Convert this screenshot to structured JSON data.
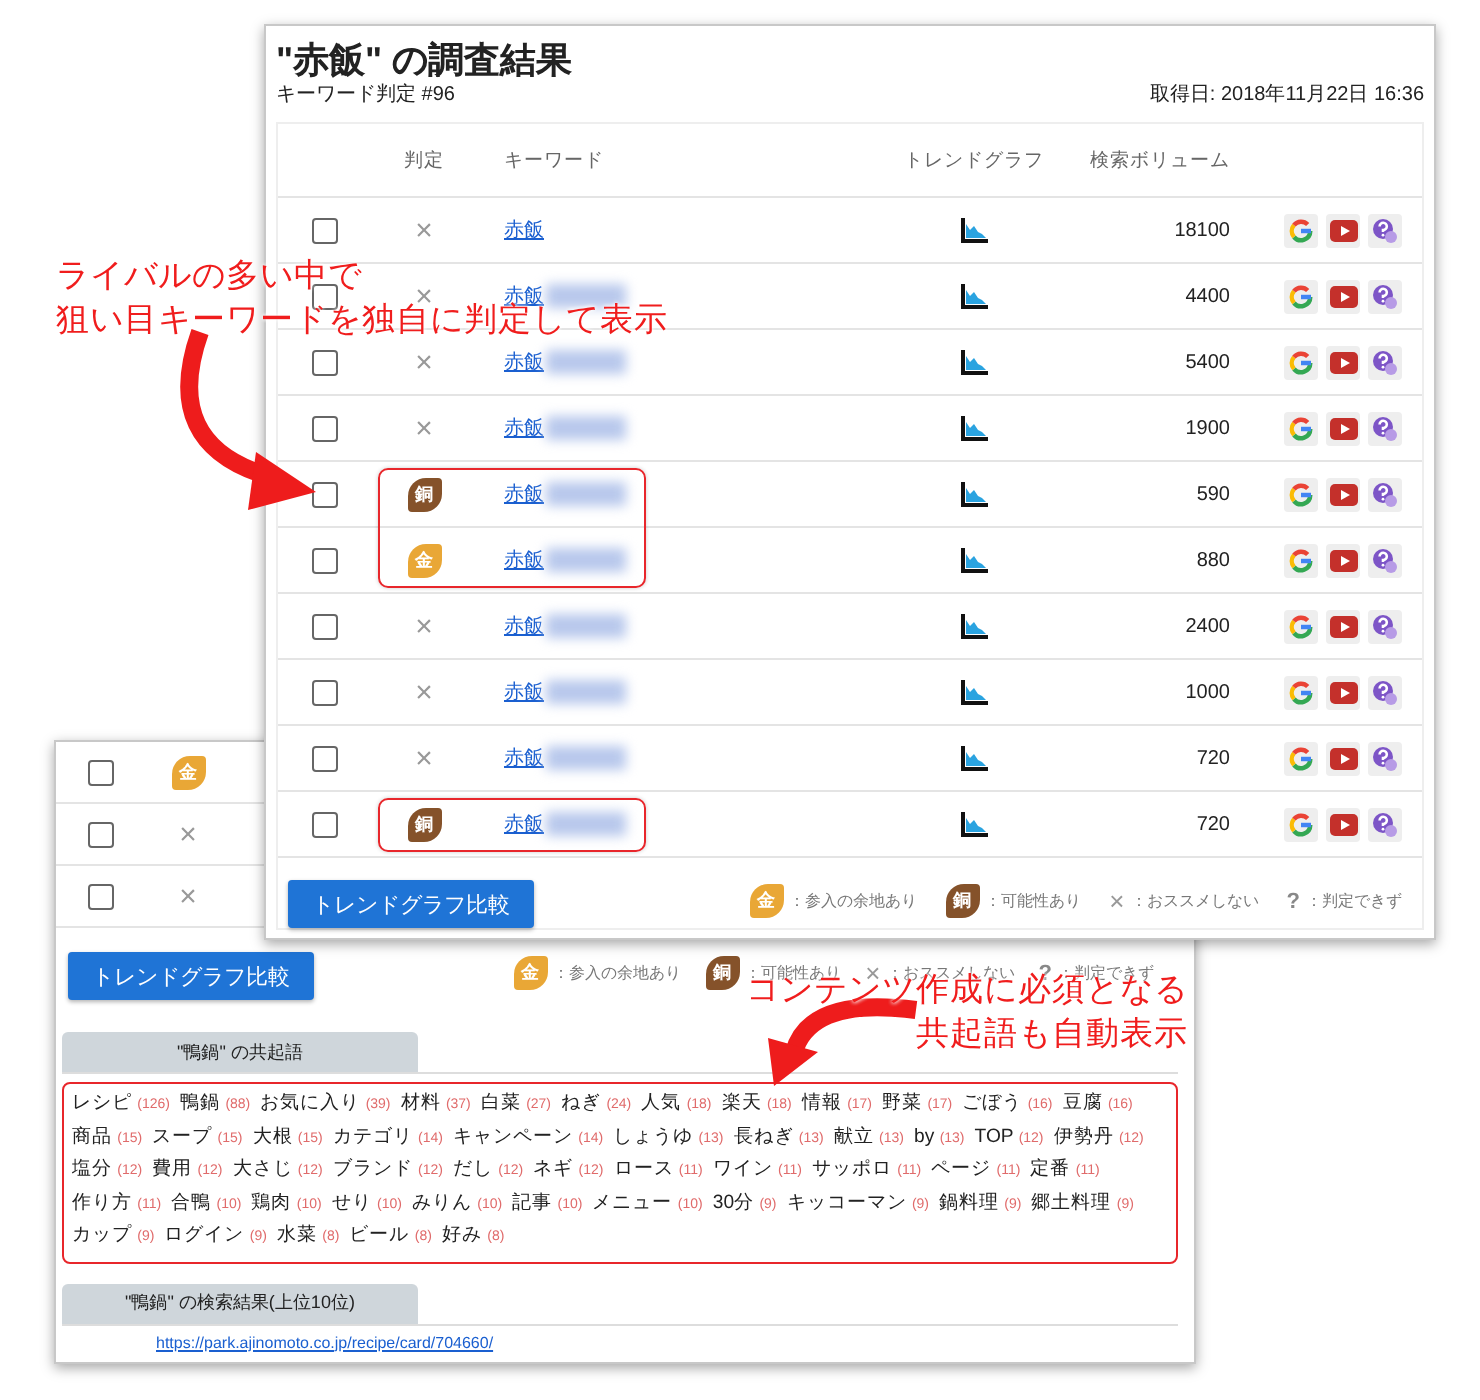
{
  "front_window": {
    "title": "\"赤飯\" の調査結果",
    "subtitle": "キーワード判定 #96",
    "fetched": "取得日: 2018年11月22日 16:36",
    "columns": [
      "判定",
      "キーワード",
      "トレンドグラフ",
      "検索ボリューム"
    ],
    "rows": [
      {
        "checked": false,
        "verdict": {
          "kind": "x",
          "text": "×"
        },
        "keyword": "赤飯",
        "blurred": false,
        "volume": "18100",
        "highlighted": false
      },
      {
        "checked": false,
        "verdict": {
          "kind": "x",
          "text": "×"
        },
        "keyword": "赤飯",
        "blurred": true,
        "volume": "4400",
        "highlighted": false
      },
      {
        "checked": false,
        "verdict": {
          "kind": "x",
          "text": "×"
        },
        "keyword": "赤飯",
        "blurred": true,
        "volume": "5400",
        "highlighted": false
      },
      {
        "checked": false,
        "verdict": {
          "kind": "x",
          "text": "×"
        },
        "keyword": "赤飯",
        "blurred": true,
        "volume": "1900",
        "highlighted": false
      },
      {
        "checked": false,
        "verdict": {
          "kind": "bronze",
          "text": "銅"
        },
        "keyword": "赤飯",
        "blurred": true,
        "volume": "590",
        "highlighted": true
      },
      {
        "checked": false,
        "verdict": {
          "kind": "gold",
          "text": "金"
        },
        "keyword": "赤飯",
        "blurred": true,
        "volume": "880",
        "highlighted": true
      },
      {
        "checked": false,
        "verdict": {
          "kind": "x",
          "text": "×"
        },
        "keyword": "赤飯",
        "blurred": true,
        "volume": "2400",
        "highlighted": false
      },
      {
        "checked": false,
        "verdict": {
          "kind": "x",
          "text": "×"
        },
        "keyword": "赤飯",
        "blurred": true,
        "volume": "1000",
        "highlighted": false
      },
      {
        "checked": false,
        "verdict": {
          "kind": "x",
          "text": "×"
        },
        "keyword": "赤飯",
        "blurred": true,
        "volume": "720",
        "highlighted": false
      },
      {
        "checked": false,
        "verdict": {
          "kind": "bronze",
          "text": "銅"
        },
        "keyword": "赤飯",
        "blurred": true,
        "volume": "720",
        "highlighted": true
      }
    ],
    "button": "トレンドグラフ比較",
    "legend": [
      {
        "kind": "gold",
        "symbol": "金",
        "label": "：参入の余地あり"
      },
      {
        "kind": "bronze",
        "symbol": "銅",
        "label": "：可能性あり"
      },
      {
        "kind": "x",
        "symbol": "×",
        "label": "：おススメしない"
      },
      {
        "kind": "q",
        "symbol": "?",
        "label": "：判定できず"
      }
    ]
  },
  "back_window": {
    "rows": [
      {
        "checked": false,
        "verdict": {
          "kind": "gold",
          "text": "金"
        }
      },
      {
        "checked": false,
        "verdict": {
          "kind": "x",
          "text": "×"
        }
      },
      {
        "checked": false,
        "verdict": {
          "kind": "x",
          "text": "×"
        }
      }
    ],
    "button": "トレンドグラフ比較",
    "legend": [
      {
        "kind": "gold",
        "symbol": "金",
        "label": "：参入の余地あり"
      },
      {
        "kind": "bronze",
        "symbol": "銅",
        "label": "：可能性あり"
      },
      {
        "kind": "x",
        "symbol": "×",
        "label": "：おススメしない"
      },
      {
        "kind": "q",
        "symbol": "?",
        "label": "：判定できず"
      }
    ],
    "cooccurrence": {
      "tab": "\"鴨鍋\" の共起語",
      "words": [
        {
          "word": "レシピ",
          "count": "(126)"
        },
        {
          "word": "鴨鍋",
          "count": "(88)"
        },
        {
          "word": "お気に入り",
          "count": "(39)"
        },
        {
          "word": "材料",
          "count": "(37)"
        },
        {
          "word": "白菜",
          "count": "(27)"
        },
        {
          "word": "ねぎ",
          "count": "(24)"
        },
        {
          "word": "人気",
          "count": "(18)"
        },
        {
          "word": "楽天",
          "count": "(18)"
        },
        {
          "word": "情報",
          "count": "(17)"
        },
        {
          "word": "野菜",
          "count": "(17)"
        },
        {
          "word": "ごぼう",
          "count": "(16)"
        },
        {
          "word": "豆腐",
          "count": "(16)"
        },
        {
          "word": "商品",
          "count": "(15)"
        },
        {
          "word": "スープ",
          "count": "(15)"
        },
        {
          "word": "大根",
          "count": "(15)"
        },
        {
          "word": "カテゴリ",
          "count": "(14)"
        },
        {
          "word": "キャンペーン",
          "count": "(14)"
        },
        {
          "word": "しょうゆ",
          "count": "(13)"
        },
        {
          "word": "長ねぎ",
          "count": "(13)"
        },
        {
          "word": "献立",
          "count": "(13)"
        },
        {
          "word": "by",
          "count": "(13)"
        },
        {
          "word": "TOP",
          "count": "(12)"
        },
        {
          "word": "伊勢丹",
          "count": "(12)"
        },
        {
          "word": "塩分",
          "count": "(12)"
        },
        {
          "word": "費用",
          "count": "(12)"
        },
        {
          "word": "大さじ",
          "count": "(12)"
        },
        {
          "word": "ブランド",
          "count": "(12)"
        },
        {
          "word": "だし",
          "count": "(12)"
        },
        {
          "word": "ネギ",
          "count": "(12)"
        },
        {
          "word": "ロース",
          "count": "(11)"
        },
        {
          "word": "ワイン",
          "count": "(11)"
        },
        {
          "word": "サッポロ",
          "count": "(11)"
        },
        {
          "word": "ページ",
          "count": "(11)"
        },
        {
          "word": "定番",
          "count": "(11)"
        },
        {
          "word": "作り方",
          "count": "(11)"
        },
        {
          "word": "合鴨",
          "count": "(10)"
        },
        {
          "word": "鶏肉",
          "count": "(10)"
        },
        {
          "word": "せり",
          "count": "(10)"
        },
        {
          "word": "みりん",
          "count": "(10)"
        },
        {
          "word": "記事",
          "count": "(10)"
        },
        {
          "word": "メニュー",
          "count": "(10)"
        },
        {
          "word": "30分",
          "count": "(9)"
        },
        {
          "word": "キッコーマン",
          "count": "(9)"
        },
        {
          "word": "鍋料理",
          "count": "(9)"
        },
        {
          "word": "郷土料理",
          "count": "(9)"
        },
        {
          "word": "カップ",
          "count": "(9)"
        },
        {
          "word": "ログイン",
          "count": "(9)"
        },
        {
          "word": "水菜",
          "count": "(8)"
        },
        {
          "word": "ビール",
          "count": "(8)"
        },
        {
          "word": "好み",
          "count": "(8)"
        }
      ]
    },
    "results": {
      "tab": "\"鴨鍋\" の検索結果(上位10位)",
      "links": [
        "https://park.ajinomoto.co.jp/recipe/card/704660/"
      ]
    }
  },
  "annotations": [
    {
      "lines": [
        "ライバルの多い中で",
        "狙い目キーワードを独自に判定して表示"
      ]
    },
    {
      "lines": [
        "コンテンツ作成に必須となる",
        "共起語も自動表示"
      ]
    }
  ]
}
